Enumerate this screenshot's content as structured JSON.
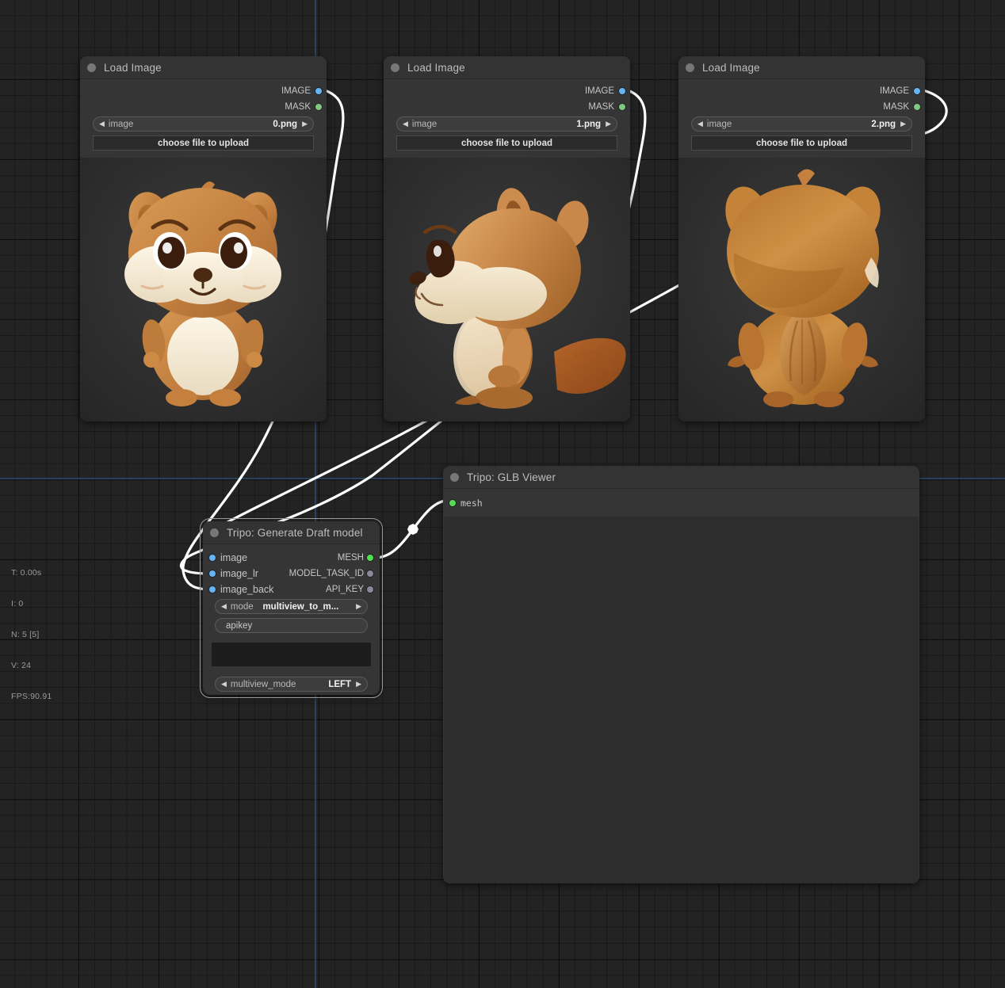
{
  "app": {
    "background_color": "#232323",
    "grid_color": "#1c1c1c",
    "axis_color": "#2e4668"
  },
  "stats": {
    "time": "T: 0.00s",
    "iterations": "I: 0",
    "nodes": "N: 5 [5]",
    "visible": "V: 24",
    "fps": "FPS:90.91"
  },
  "nodes": {
    "load_image_0": {
      "title": "Load Image",
      "outputs": [
        {
          "label": "IMAGE",
          "color": "#64b5f6"
        },
        {
          "label": "MASK",
          "color": "#81c784"
        }
      ],
      "widget_image": {
        "name": "image",
        "value": "0.png"
      },
      "upload_button": "choose file to upload",
      "preview_alt": "squirrel-front-view"
    },
    "load_image_1": {
      "title": "Load Image",
      "outputs": [
        {
          "label": "IMAGE",
          "color": "#64b5f6"
        },
        {
          "label": "MASK",
          "color": "#81c784"
        }
      ],
      "widget_image": {
        "name": "image",
        "value": "1.png"
      },
      "upload_button": "choose file to upload",
      "preview_alt": "squirrel-side-view"
    },
    "load_image_2": {
      "title": "Load Image",
      "outputs": [
        {
          "label": "IMAGE",
          "color": "#64b5f6"
        },
        {
          "label": "MASK",
          "color": "#81c784"
        }
      ],
      "widget_image": {
        "name": "image",
        "value": "2.png"
      },
      "upload_button": "choose file to upload",
      "preview_alt": "squirrel-back-view"
    },
    "tripo_generate": {
      "title": "Tripo: Generate Draft model",
      "selected": true,
      "inputs": [
        {
          "label": "image",
          "color": "#64b5f6"
        },
        {
          "label": "image_lr",
          "color": "#64b5f6"
        },
        {
          "label": "image_back",
          "color": "#64b5f6"
        }
      ],
      "outputs": [
        {
          "label": "MESH",
          "color": "#52e052"
        },
        {
          "label": "MODEL_TASK_ID",
          "color": "#8a8a99"
        },
        {
          "label": "API_KEY",
          "color": "#8a8a99"
        }
      ],
      "widget_mode": {
        "name": "mode",
        "value": "multiview_to_m..."
      },
      "widget_apikey": {
        "placeholder": "apikey",
        "value": ""
      },
      "widget_multiline": {
        "value": ""
      },
      "widget_multiview_mode": {
        "name": "multiview_mode",
        "value": "LEFT"
      }
    },
    "glb_viewer": {
      "title": "Tripo: GLB Viewer",
      "inputs": [
        {
          "label": "mesh",
          "color": "#52e052"
        }
      ]
    }
  }
}
